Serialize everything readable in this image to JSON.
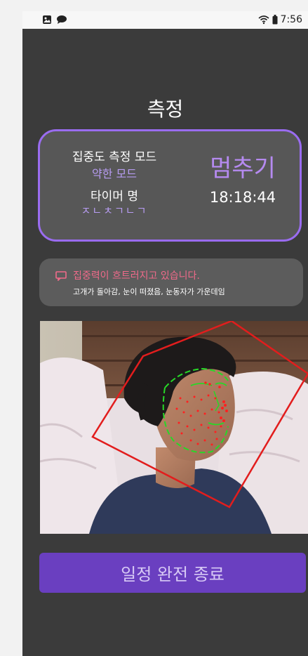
{
  "status_bar": {
    "icons": [
      "gallery-icon",
      "chat-bubble-icon",
      "wifi-icon",
      "battery-icon"
    ],
    "time": "7:56"
  },
  "page": {
    "title": "측정"
  },
  "measure_card": {
    "mode_label": "집중도 측정 모드",
    "mode_value": "약한 모드",
    "timer_label": "타이머 명",
    "timer_value": "ㅈㄴㅊㄱㄴㄱ",
    "stop_label": "멈추기",
    "clock": "18:18:44"
  },
  "alert": {
    "icon": "chat-bubble-icon",
    "title": "집중력이 흐트러지고 있습니다.",
    "detail": "고개가 돌아감, 눈이 떠졌음, 눈동자가 가운데임"
  },
  "camera": {
    "description": "face-tracking camera preview"
  },
  "action": {
    "label": "일정 완전 종료"
  },
  "colors": {
    "background": "#3b3b3b",
    "accent": "#9a6cf0",
    "alert_text": "#f06a8a",
    "button": "#6a3fc0"
  }
}
